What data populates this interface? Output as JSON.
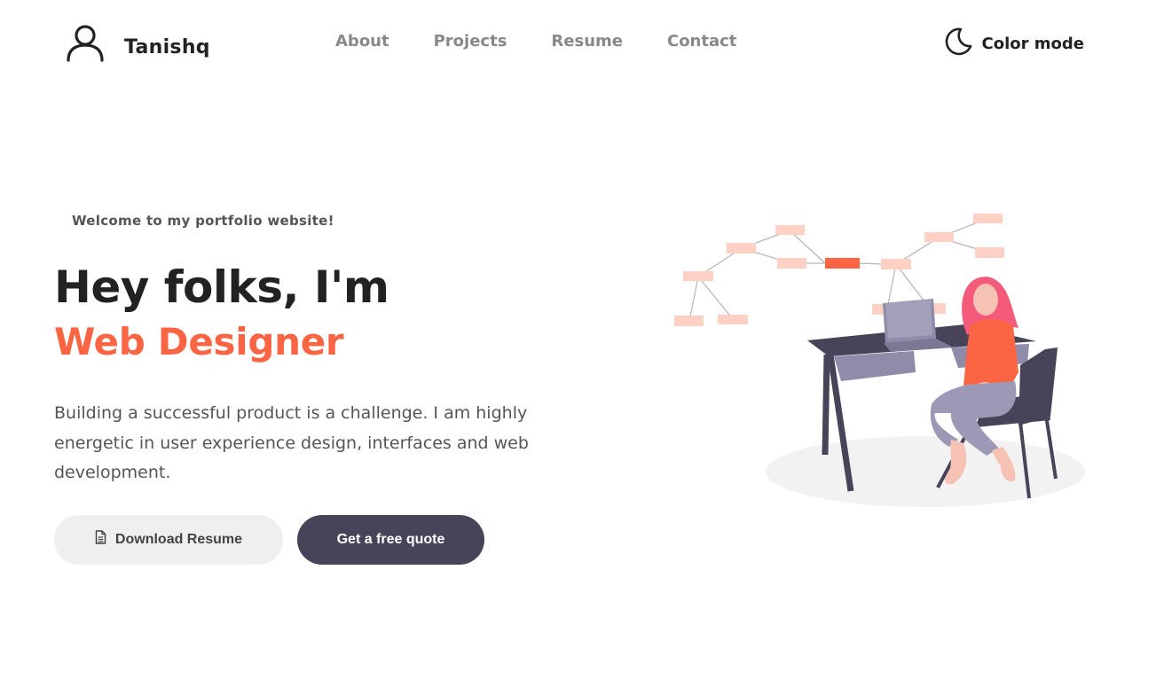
{
  "brand": {
    "name": "Tanishq",
    "icon": "user-icon"
  },
  "nav": {
    "items": [
      {
        "label": "About"
      },
      {
        "label": "Projects"
      },
      {
        "label": "Resume"
      },
      {
        "label": "Contact"
      }
    ]
  },
  "color_mode": {
    "label": "Color mode",
    "icon": "moon-icon"
  },
  "hero": {
    "welcome": "Welcome to my portfolio website!",
    "headline": "Hey folks, I'm",
    "role": "Web Designer",
    "description": "Building a successful product is a challenge. I am highly energetic in user experience design, interfaces and web development.",
    "download_label": "Download Resume",
    "download_icon": "document-icon",
    "quote_label": "Get a free quote"
  },
  "colors": {
    "accent": "#fc6544",
    "dark": "#47445a",
    "muted": "#888888",
    "button_light": "#efefef"
  }
}
